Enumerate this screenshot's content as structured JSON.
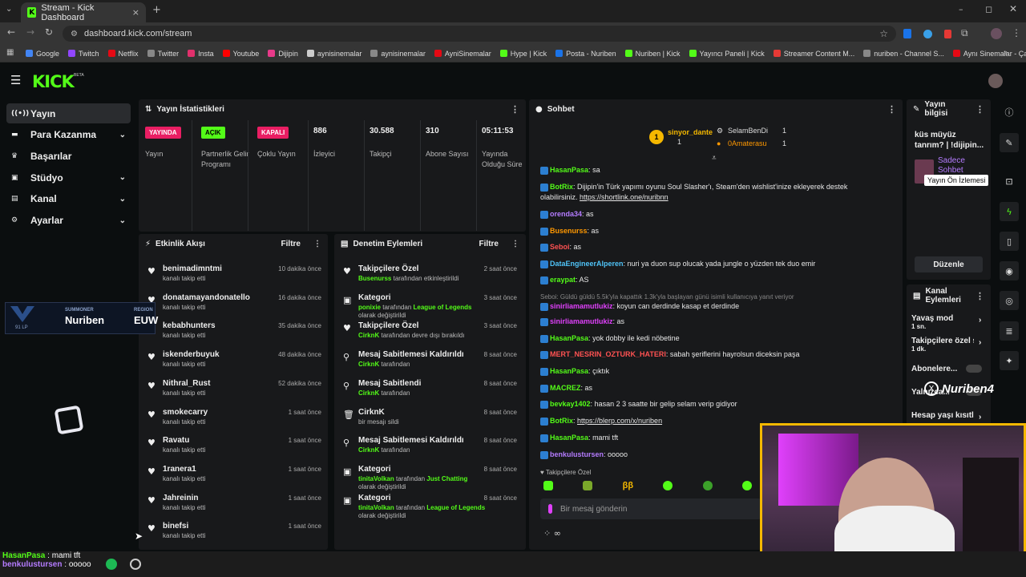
{
  "browser": {
    "tab_title": "Stream - Kick Dashboard",
    "url": "dashboard.kick.com/stream",
    "bookmarks": [
      {
        "label": "Google",
        "color": "#4285f4"
      },
      {
        "label": "Twitch",
        "color": "#9146ff"
      },
      {
        "label": "Netflix",
        "color": "#e50914"
      },
      {
        "label": "Twitter",
        "color": "#888888"
      },
      {
        "label": "Insta",
        "color": "#e1306c"
      },
      {
        "label": "Youtube",
        "color": "#ff0000"
      },
      {
        "label": "Dijipin",
        "color": "#e83a8a"
      },
      {
        "label": "aynisinemalar",
        "color": "#cccccc"
      },
      {
        "label": "aynisinemalar",
        "color": "#888888"
      },
      {
        "label": "AyniSinemalar",
        "color": "#e50914"
      },
      {
        "label": "Hype | Kick",
        "color": "#53fc18"
      },
      {
        "label": "Posta - Nuriben",
        "color": "#1a73e8"
      },
      {
        "label": "Nuriben | Kick",
        "color": "#53fc18"
      },
      {
        "label": "Yayıncı Paneli | Kick",
        "color": "#53fc18"
      },
      {
        "label": "Streamer Content M...",
        "color": "#e53935"
      },
      {
        "label": "nuriben - Channel S...",
        "color": "#888888"
      },
      {
        "label": "Aynı Sinemalar - Ça...",
        "color": "#e50914"
      }
    ]
  },
  "app": {
    "logo": "KICK",
    "beta": "BETA"
  },
  "nav": [
    {
      "label": "Yayın",
      "icon": "broadcast-icon",
      "active": true
    },
    {
      "label": "Para Kazanma",
      "icon": "money-icon",
      "chev": true
    },
    {
      "label": "Başarılar",
      "icon": "trophy-icon"
    },
    {
      "label": "Stüdyo",
      "icon": "studio-icon",
      "chev": true
    },
    {
      "label": "Kanal",
      "icon": "channel-icon",
      "chev": true
    },
    {
      "label": "Ayarlar",
      "icon": "gear-icon",
      "chev": true
    }
  ],
  "stats": {
    "title": "Yayın İstatistikleri",
    "badges": [
      {
        "text": "YAYINDA",
        "label": "Yayın",
        "color": "#e91e63"
      },
      {
        "text": "AÇIK",
        "label": "Partnerlik Gelir Programı",
        "color": "#53fc18"
      },
      {
        "text": "KAPALI",
        "label": "Çoklu Yayın",
        "color": "#e91e63"
      }
    ],
    "numbers": [
      {
        "value": "886",
        "label": "İzleyici"
      },
      {
        "value": "30.588",
        "label": "Takipçi"
      },
      {
        "value": "310",
        "label": "Abone Sayısı"
      },
      {
        "value": "05:11:53",
        "label": "Yayında Olduğu Süre"
      }
    ]
  },
  "activity": {
    "title": "Etkinlik Akışı",
    "filter": "Filtre",
    "items": [
      {
        "name": "benimadimntmi",
        "sub": "kanalı takip etti",
        "time": "10 dakika önce"
      },
      {
        "name": "donatamayandonatello",
        "sub": "kanalı takip etti",
        "time": "16 dakika önce"
      },
      {
        "name": "kebabhunters",
        "sub": "kanalı takip etti",
        "time": "35 dakika önce"
      },
      {
        "name": "iskenderbuyuk",
        "sub": "kanalı takip etti",
        "time": "48 dakika önce"
      },
      {
        "name": "Nithral_Rust",
        "sub": "kanalı takip etti",
        "time": "52 dakika önce"
      },
      {
        "name": "smokecarry",
        "sub": "kanalı takip etti",
        "time": "1 saat önce"
      },
      {
        "name": "Ravatu",
        "sub": "kanalı takip etti",
        "time": "1 saat önce"
      },
      {
        "name": "1ranera1",
        "sub": "kanalı takip etti",
        "time": "1 saat önce"
      },
      {
        "name": "Jahreinin",
        "sub": "kanalı takip etti",
        "time": "1 saat önce"
      },
      {
        "name": "binefsi",
        "sub": "kanalı takip etti",
        "time": "1 saat önce"
      }
    ]
  },
  "moderation": {
    "title": "Denetim Eylemleri",
    "filter": "Filtre",
    "items": [
      {
        "icon": "heart-icon",
        "name": "Takipçilere Özel",
        "actor": "Busenurss",
        "sub": "tarafından etkinleştirildi",
        "time": "2 saat önce"
      },
      {
        "icon": "category-icon",
        "name": "Kategori",
        "actor": "ponixie",
        "sub": "tarafından",
        "extra": "League of Legends",
        "sub2": "olarak değiştirildi",
        "time": "3 saat önce"
      },
      {
        "icon": "heart-icon",
        "name": "Takipçilere Özel",
        "actor": "CirknK",
        "sub": "tarafından devre dışı bırakıldı",
        "time": "3 saat önce"
      },
      {
        "icon": "unpin-icon",
        "name": "Mesaj Sabitlemesi Kaldırıldı",
        "actor": "CirknK",
        "sub": "tarafından",
        "time": "8 saat önce"
      },
      {
        "icon": "pin-icon",
        "name": "Mesaj Sabitlendi",
        "actor": "CirknK",
        "sub": "tarafından",
        "time": "8 saat önce"
      },
      {
        "icon": "trash-icon",
        "name": "CirknK",
        "actor": "",
        "sub": "bir mesajı sildi",
        "time": "8 saat önce"
      },
      {
        "icon": "unpin-icon",
        "name": "Mesaj Sabitlemesi Kaldırıldı",
        "actor": "CirknK",
        "sub": "tarafından",
        "time": "8 saat önce"
      },
      {
        "icon": "category-icon",
        "name": "Kategori",
        "actor": "tinitaVolkan",
        "sub": "tarafından",
        "extra": "Just Chatting",
        "sub2": "olarak değiştirildi",
        "time": "8 saat önce"
      },
      {
        "icon": "category-icon",
        "name": "Kategori",
        "actor": "tinitaVolkan",
        "sub": "tarafından",
        "extra": "League of Legends",
        "sub2": "olarak değiştirildi",
        "time": "8 saat önce"
      }
    ]
  },
  "chat": {
    "title": "Sohbet",
    "leaders": [
      {
        "name": "sinyor_dante",
        "count": "1"
      },
      {
        "name": "SelamBenDi",
        "count": "1"
      },
      {
        "name": "0Amaterasu",
        "count": "1"
      }
    ],
    "messages": [
      {
        "user": "HasanPasa",
        "color": "#53fc18",
        "text": "sa"
      },
      {
        "user": "BotRix",
        "color": "#53fc18",
        "text": "Dijipin'in Türk yapımı oyunu Soul Slasher'ı, Steam'den wishlist'inize ekleyerek destek olabilirsiniz.",
        "link": "https://shortlink.one/nuribnn"
      },
      {
        "user": "orenda34",
        "color": "#b57cff",
        "text": "as"
      },
      {
        "user": "Busenurss",
        "color": "#ff9800",
        "text": "as"
      },
      {
        "user": "Seboi",
        "color": "#ff5252",
        "text": "as"
      },
      {
        "user": "DataEngineerAlperen",
        "color": "#4fc3f7",
        "text": "nuri ya duon sup olucak yada jungle o yüzden tek duo emir"
      },
      {
        "user": "eraypat",
        "color": "#53fc18",
        "text": "AS"
      },
      {
        "reply": "Seboi: Güldü güldü 5.5k'yla kapattık 1.3k'yla başlayan günü isimli kullanıcıya yanıt veriyor",
        "user": "sinirliamamutlukiz",
        "color": "#e040fb",
        "text": "koyun can derdinde kasap et derdinde"
      },
      {
        "user": "sinirliamamutlukiz",
        "color": "#e040fb",
        "text": "as"
      },
      {
        "user": "HasanPasa",
        "color": "#53fc18",
        "text": "yok dobby ile kedi nöbetine"
      },
      {
        "user": "MERT_NESRIN_OZTURK_HATERI",
        "color": "#ff5252",
        "text": "sabah şeriflerini hayrolsun diceksin paşa"
      },
      {
        "user": "HasanPasa",
        "color": "#53fc18",
        "text": "çıktık"
      },
      {
        "user": "MACREZ",
        "color": "#53fc18",
        "text": "as"
      },
      {
        "user": "bevkay1402",
        "color": "#53fc18",
        "text": "hasan 2 3 saatte bir gelip selam verip gidiyor"
      },
      {
        "user": "BotRix",
        "color": "#53fc18",
        "text": "",
        "link": "https://blerp.com/x/nuriben"
      },
      {
        "user": "HasanPasa",
        "color": "#53fc18",
        "text": "mami tft"
      },
      {
        "user": "benkulustursen",
        "color": "#b57cff",
        "text": "ooooo"
      }
    ],
    "mode": "Takipçilere Özel",
    "placeholder": "Bir mesaj gönderin"
  },
  "info": {
    "title": "Yayın bilgisi",
    "stream_title": "küs müyüz tanrım? | !dijipin...",
    "chat_mode": "Sadece Sohbet",
    "tooltip": "Yayın Ön İzlemesi",
    "edit": "Düzenle"
  },
  "channel_actions": {
    "title": "Kanal Eylemleri",
    "items": [
      {
        "label": "Yavaş mod",
        "value": "1 sn."
      },
      {
        "label": "Takipçilere özel s",
        "value": "1 dk."
      },
      {
        "label": "Abonelere...",
        "value": ""
      },
      {
        "label": "Yalnızca...",
        "value": ""
      },
      {
        "label": "Hesap yaşı kısıtl",
        "value": ""
      }
    ]
  },
  "overlay": {
    "summoner_label": "SUMMONER",
    "summoner": "Nuriben",
    "region_label": "REGION",
    "region": "EUW",
    "lp": "91 LP",
    "watermark": "Nuriben4",
    "taskbar_chat": [
      {
        "user": "HasanPasa",
        "text": "mami tft"
      },
      {
        "user": "benkulustursen",
        "text": "ooooo"
      }
    ]
  }
}
